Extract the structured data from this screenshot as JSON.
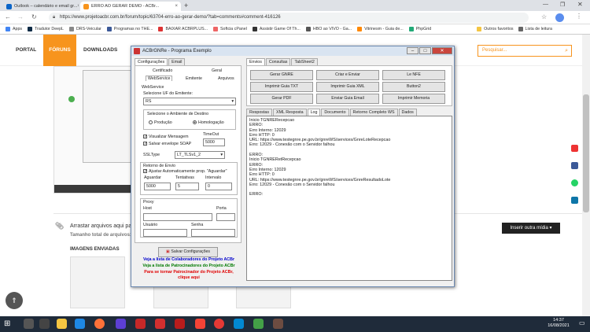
{
  "browser": {
    "tabs": [
      {
        "label": "Outlook – calendário e email gr..."
      },
      {
        "label": "ERRO AO GERAR DEMO - ACBr..."
      }
    ],
    "url": "https://www.projetoacbr.com.br/forum/topic/63704-erro-ao-gerar-demo/?tab=comments#comment-416126",
    "bookmarks": [
      "Apps",
      "Tradutor DeepL",
      "DRS-Veicular",
      "Programas no THE...",
      "BAIXAR ACBRPLUS...",
      "Softcia cPanel",
      "Assistir Game Of Th...",
      "HBO ao VIVO - Ga...",
      "Vitrinesm - Guia de...",
      "PhpGrid",
      "Outros favoritos",
      "Lista de leitura"
    ]
  },
  "site": {
    "nav": [
      "PORTAL",
      "FÓRUNS",
      "DOWNLOADS"
    ],
    "search_placeholder": "Pesquisar...",
    "attach_text": "Arrastar arquivos aqui par",
    "size_text": "Tamanho total de arquivos:",
    "images_title": "IMAGENS ENVIADAS",
    "insert_media": "Inserir outra mídia"
  },
  "app": {
    "title": "ACBrGNRe - Programa Exemplo",
    "left_tabs": [
      "Configurações",
      "Email"
    ],
    "sub_tabs_top": [
      "Certificado",
      "Geral"
    ],
    "sub_tabs_bottom": [
      "WebService",
      "Emitente",
      "Arquivos"
    ],
    "webservice_group": "WebService",
    "uf_label": "Selecione UF do Emitente:",
    "uf_value": "RS",
    "ambiente_label": "Selecione o Ambiente de Destino",
    "producao": "Produção",
    "homologacao": "Homologação",
    "visualizar": "Visualizar Mensagem",
    "salvar_soap": "Salvar envelope SOAP",
    "timeout_label": "TimeOut",
    "timeout_value": "5000",
    "ssltype_label": "SSLType",
    "ssltype_value": "LT_TLSv1_2",
    "retorno_group": "Retorno de Envio",
    "ajustar": "Ajustar Automaticamente prop. \"Aguardar\"",
    "aguardar_label": "Aguardar",
    "aguardar_value": "5000",
    "tentativas_label": "Tentativas",
    "tentativas_value": "5",
    "intervalo_label": "Intervalo",
    "intervalo_value": "0",
    "proxy_group": "Proxy",
    "host_label": "Host",
    "porta_label": "Porta",
    "usuario_label": "Usuário",
    "senha_label": "Senha",
    "save_config": "Salvar Configurações",
    "link1": "Veja a lista de Colaboradores do Projeto ACBr",
    "link2": "Veja a lista de Patrocinadores do Projeto ACBr",
    "link3a": "Para se tornar Patrocinador do Projeto ACBr,",
    "link3b": "clique aqui",
    "right_tabs": [
      "Envios",
      "Consultas",
      "TabSheet2"
    ],
    "buttons": [
      "Gerar GNRE",
      "Criar e Enviar",
      "Le NFE",
      "Imprimir Guia TXT",
      "Imprimir Guia XML",
      "Button2",
      "Gerar PDF",
      "Enviar Guia Email",
      "Imprimir Memoria"
    ],
    "result_tabs": [
      "Respostas",
      "XML Resposta",
      "Log",
      "Documento",
      "Retorno Completo WS",
      "Dados"
    ],
    "log": "Inicio TGNRERecepcao\nERRO:\nErro Interno: 12029\nErro HTTP: 0\nURL: https://www.testegnre.pe.gov.br/gnreWS/services/GnreLoteRecepcao\nErro: 12029 - Conexão com o Servidor falhou\n\nERRO:\nInicio TGNRERetRecepcao\nERRO:\nErro Interno: 12029\nErro HTTP: 0\nURL: https://www.testegnre.pe.gov.br/gnreWS/services/GnreResultadoLote\nErro: 12029 - Conexão com o Servidor falhou\n\nERRO:"
  },
  "taskbar": {
    "time": "14:37",
    "date": "16/08/2021"
  },
  "colors": {
    "accent": "#f7941d",
    "taskbar": "#1f2b3a",
    "link_blue": "#0000cc",
    "link_green": "#007a00",
    "link_red": "#e00000"
  }
}
